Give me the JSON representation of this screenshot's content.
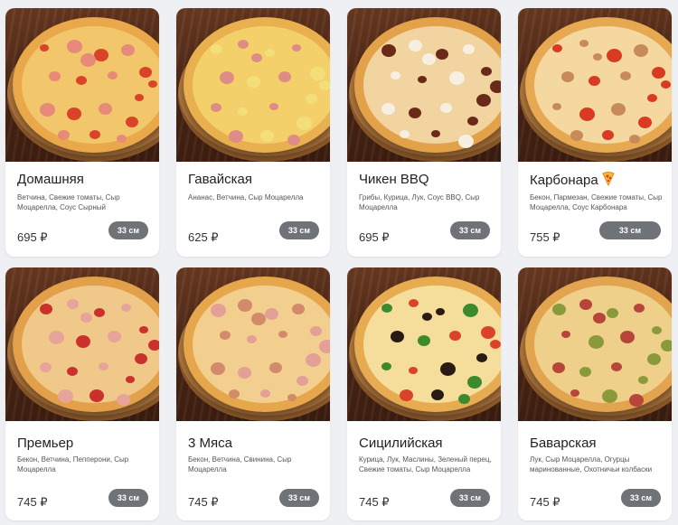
{
  "currency_suffix": "₽",
  "size_label": "33 см",
  "products": [
    {
      "name": "Домашняя",
      "desc": "Ветчина, Свежие томаты, Сыр Моцарелла, Соус Сырный",
      "price": "695 ₽",
      "size": "33 см",
      "crust": "#e9a94a",
      "cheese": "#f2c66a",
      "toppings": [
        "#d8432a",
        "#e78a7a"
      ]
    },
    {
      "name": "Гавайская",
      "desc": "Ананас, Ветчина, Сыр Моцарелла",
      "price": "625 ₽",
      "size": "33 см",
      "crust": "#e9b04f",
      "cheese": "#f4d06b",
      "toppings": [
        "#f3df7a",
        "#e08c86"
      ]
    },
    {
      "name": "Чикен BBQ",
      "desc": "Грибы, Курица, Лук, Соус BBQ, Сыр Моцарелла",
      "price": "695 ₽",
      "size": "33 см",
      "crust": "#e3a24a",
      "cheese": "#f1d4a0",
      "toppings": [
        "#6a2a18",
        "#f6efe2"
      ]
    },
    {
      "name": "Карбонара",
      "desc": "Бекон, Пармезан, Свежие томаты, Сыр Моцарелла, Соус Карбонара",
      "price": "755 ₽",
      "size": "33 см",
      "crust": "#e6a850",
      "cheese": "#f4d8a0",
      "toppings": [
        "#d83a22",
        "#c98a5a"
      ],
      "badge": "pizza-icon"
    },
    {
      "name": "Премьер",
      "desc": "Бекон, Ветчина, Пепперони, Сыр Моцарелла",
      "price": "745 ₽",
      "size": "33 см",
      "crust": "#e3a04a",
      "cheese": "#f0c98a",
      "toppings": [
        "#c9312a",
        "#e7a49a"
      ]
    },
    {
      "name": "3 Мяса",
      "desc": "Бекон, Ветчина, Свинина, Сыр Моцарелла",
      "price": "745 ₽",
      "size": "33 см",
      "crust": "#e6a64c",
      "cheese": "#f2cf8f",
      "toppings": [
        "#e2a097",
        "#d38a6a"
      ]
    },
    {
      "name": "Сицилийская",
      "desc": "Курица, Лук, Маслины, Зеленый перец, Свежие томаты, Сыр Моцарелла",
      "price": "745 ₽",
      "size": "33 см",
      "crust": "#e7ab52",
      "cheese": "#f5dd9c",
      "toppings": [
        "#3c8a2c",
        "#d8432a",
        "#2a1a14"
      ]
    },
    {
      "name": "Баварская",
      "desc": "Лук, Сыр Моцарелла, Огурцы маринованные, Охотничьи колбаски",
      "price": "745 ₽",
      "size": "33 см",
      "crust": "#e2a44e",
      "cheese": "#efd08a",
      "toppings": [
        "#8a9a3a",
        "#b8453a"
      ]
    }
  ]
}
